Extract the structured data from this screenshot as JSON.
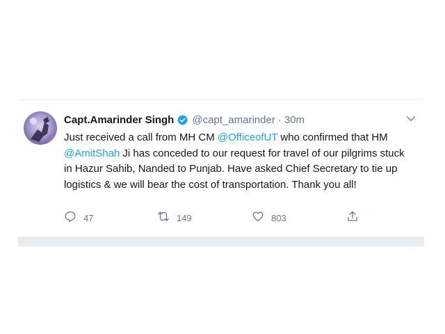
{
  "tweet": {
    "author": {
      "name": "Capt.Amarinder Singh",
      "handle": "@capt_amarinder",
      "verified": true
    },
    "separator": "·",
    "time": "30m",
    "text": {
      "part1": "Just received a call from MH CM ",
      "mention1": "@OfficeofUT",
      "part2": " who confirmed that HM ",
      "mention2": "@AmitShah",
      "part3": " Ji has conceded to our request for travel of our pilgrims stuck in Hazur Sahib, Nanded to Punjab. Have asked Chief Secretary to tie up logistics & we will bear the cost of transportation. Thank you all!"
    },
    "actions": {
      "reply_count": "47",
      "retweet_count": "149",
      "like_count": "803"
    }
  },
  "colors": {
    "link": "#1da1f2",
    "text": "#14171a",
    "muted": "#657786",
    "divider": "#e6ecf0"
  },
  "icons": {
    "verified": "verified-badge-icon",
    "menu": "chevron-down-icon",
    "reply": "reply-icon",
    "retweet": "retweet-icon",
    "like": "heart-icon",
    "share": "share-icon"
  }
}
